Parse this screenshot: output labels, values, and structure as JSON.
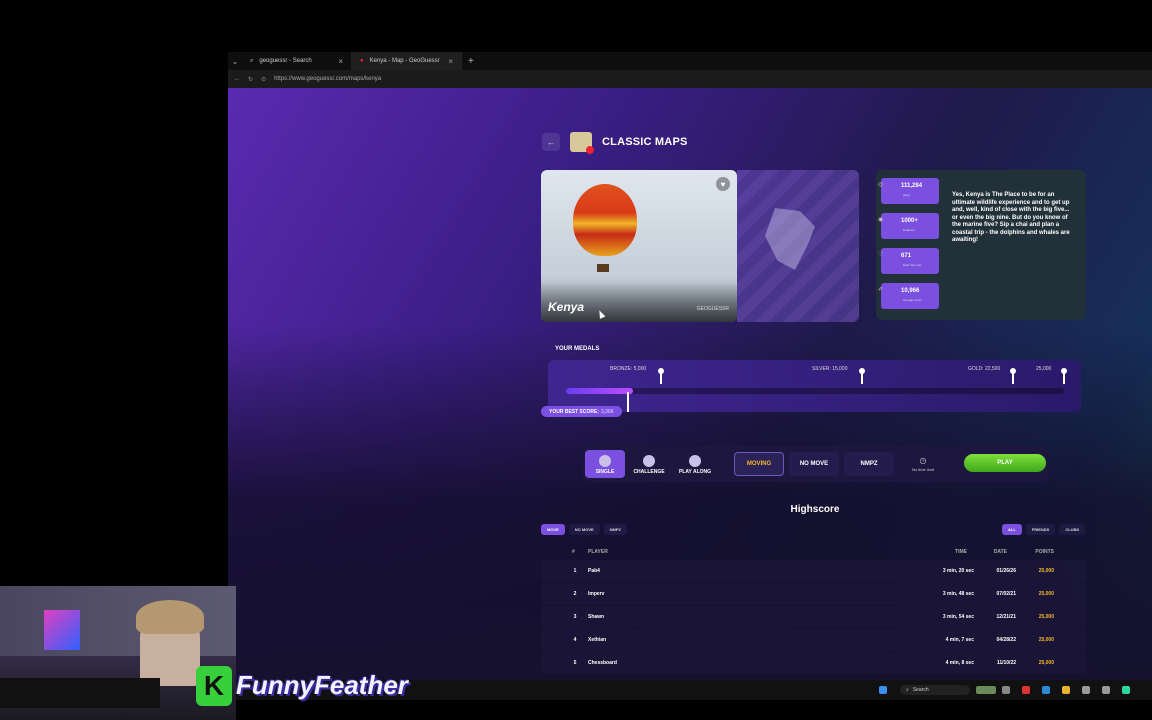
{
  "browser": {
    "tabs": [
      {
        "label": "geoguessr - Search",
        "active": false
      },
      {
        "label": "Kenya - Map - GeoGuessr",
        "active": true
      }
    ],
    "url": "https://www.geoguessr.com/maps/kenya"
  },
  "header": {
    "title": "CLASSIC MAPS"
  },
  "map_card": {
    "name": "Kenya",
    "creator": "GEOGUESSR"
  },
  "stats": [
    {
      "icon": "plays-icon",
      "value": "111,284",
      "label": "plays"
    },
    {
      "icon": "locations-icon",
      "value": "1000+",
      "label": "locations"
    },
    {
      "icon": "likes-icon",
      "value": "671",
      "label": "liked this map"
    },
    {
      "icon": "score-icon",
      "value": "10,966",
      "label": "average score"
    }
  ],
  "description": "Yes, Kenya is The Place to be for an ultimate wildlife experience and to get up and, well, kind of close with the big five... or even the big nine. But do you know of the marine five? Sip a chai and plan a coastal trip - the dolphins and whales are awaiting!",
  "medals": {
    "label": "YOUR MEDALS",
    "bronze": "BRONZE: 5,000",
    "silver": "SILVER: 15,000",
    "gold": "GOLD: 22,500",
    "max": "25,000",
    "best_label": "YOUR BEST SCORE:",
    "best_value": "3,366",
    "best_fraction": 0.1346
  },
  "modes": [
    {
      "label": "SINGLE",
      "active": true
    },
    {
      "label": "CHALLENGE",
      "active": false
    },
    {
      "label": "PLAY ALONG",
      "active": false
    }
  ],
  "options": [
    {
      "label": "MOVING",
      "active": true
    },
    {
      "label": "NO MOVE",
      "active": false
    },
    {
      "label": "NMPZ",
      "active": false
    }
  ],
  "timer": "No time limit",
  "play_label": "PLAY",
  "highscore": {
    "title": "Highscore",
    "type_filters": [
      "MOVE",
      "NO MOVE",
      "NMPZ"
    ],
    "scope_filters": [
      "ALL",
      "FRIENDS",
      "CLUBS"
    ],
    "columns": {
      "rank": "#",
      "player": "PLAYER",
      "time": "TIME",
      "date": "DATE",
      "points": "POINTS"
    },
    "rows": [
      {
        "rank": "1",
        "player": "Pab4",
        "time": "3 min, 20 sec",
        "date": "01/26/26",
        "points": "25,000"
      },
      {
        "rank": "2",
        "player": "Imperv",
        "time": "3 min, 48 sec",
        "date": "07/02/21",
        "points": "25,000"
      },
      {
        "rank": "3",
        "player": "Shawn",
        "time": "3 min, 54 sec",
        "date": "12/21/21",
        "points": "25,000"
      },
      {
        "rank": "4",
        "player": "Xethian",
        "time": "4 min, 7 sec",
        "date": "04/28/22",
        "points": "25,000"
      },
      {
        "rank": "5",
        "player": "Chessboard",
        "time": "4 min, 8 sec",
        "date": "11/10/22",
        "points": "25,000"
      }
    ]
  },
  "taskbar": {
    "search": "Search"
  },
  "overlay": {
    "logo": "K",
    "brand": "FunnyFeather"
  }
}
